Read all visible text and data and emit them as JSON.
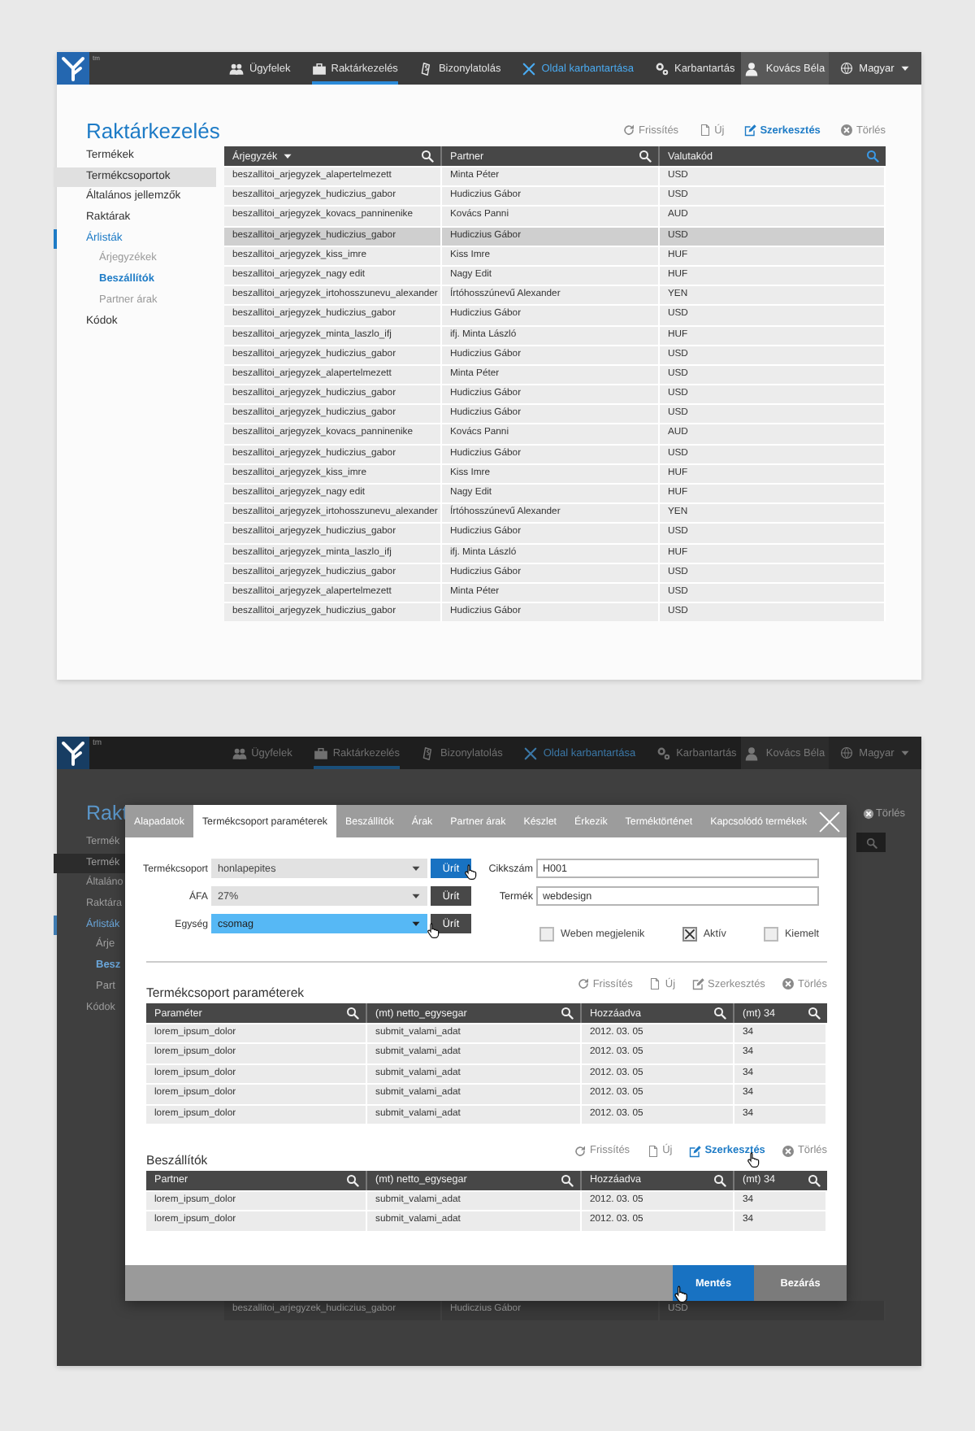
{
  "main_view": {
    "app": {
      "trademark": "tm"
    },
    "nav": [
      {
        "label": "Ügyfelek",
        "kind": "people",
        "selected": false,
        "highlighted": false
      },
      {
        "label": "Raktárkezelés",
        "kind": "briefcase",
        "selected": true,
        "highlighted": false
      },
      {
        "label": "Bizonylatolás",
        "kind": "receipt",
        "selected": false,
        "highlighted": false
      },
      {
        "label": "Oldal karbantartása",
        "kind": "tools",
        "selected": false,
        "highlighted": true
      },
      {
        "label": "Karbantartás",
        "kind": "gears",
        "selected": false,
        "highlighted": false
      }
    ],
    "user": {
      "name": "Kovács Béla"
    },
    "language": {
      "label": "Magyar"
    },
    "title": "Raktárkezelés",
    "toolbar": [
      {
        "label": "Frissítés",
        "kind": "refresh",
        "active": false
      },
      {
        "label": "Új",
        "kind": "new",
        "active": false
      },
      {
        "label": "Szerkesztés",
        "kind": "edit",
        "active": true
      },
      {
        "label": "Törlés",
        "kind": "delete",
        "active": false
      }
    ],
    "sidebar": {
      "items": [
        {
          "label": "Termékek",
          "selected": false,
          "expanded": false
        },
        {
          "label": "Termékcsoportok",
          "selected": true,
          "expanded": false
        },
        {
          "label": "Általános jellemzők",
          "selected": false,
          "expanded": false
        },
        {
          "label": "Raktárak",
          "selected": false,
          "expanded": false
        },
        {
          "label": "Árlisták",
          "selected": false,
          "expanded": true,
          "children": [
            {
              "label": "Árjegyzékek",
              "selected": false
            },
            {
              "label": "Beszállítók",
              "selected": true
            },
            {
              "label": "Partner árak",
              "selected": false
            }
          ]
        },
        {
          "label": "Kódok",
          "selected": false,
          "expanded": false
        }
      ]
    },
    "table": {
      "columns": [
        {
          "label": "Árjegyzék",
          "sortable": true,
          "search_active": false
        },
        {
          "label": "Partner",
          "sortable": false,
          "search_active": false
        },
        {
          "label": "Valutakód",
          "sortable": false,
          "search_active": true
        }
      ],
      "rows": [
        {
          "cells": [
            "beszallitoi_arjegyzek_alapertelmezett",
            "Minta Péter",
            "USD"
          ],
          "selected": false
        },
        {
          "cells": [
            "beszallitoi_arjegyzek_hudiczius_gabor",
            "Hudiczius Gábor",
            "USD"
          ],
          "selected": false
        },
        {
          "cells": [
            "beszallitoi_arjegyzek_kovacs_panninenike",
            "Kovács Panni",
            "AUD"
          ],
          "selected": false
        },
        {
          "cells": [
            "beszallitoi_arjegyzek_hudiczius_gabor",
            "Hudiczius Gábor",
            "USD"
          ],
          "selected": true
        },
        {
          "cells": [
            "beszallitoi_arjegyzek_kiss_imre",
            "Kiss Imre",
            "HUF"
          ],
          "selected": false
        },
        {
          "cells": [
            "beszallitoi_arjegyzek_nagy edit",
            "Nagy Edit",
            "HUF"
          ],
          "selected": false
        },
        {
          "cells": [
            "beszallitoi_arjegyzek_irtohosszunevu_alexander",
            "Írtóhosszúnevű Alexander",
            "YEN"
          ],
          "selected": false
        },
        {
          "cells": [
            "beszallitoi_arjegyzek_hudiczius_gabor",
            "Hudiczius Gábor",
            "USD"
          ],
          "selected": false
        },
        {
          "cells": [
            "beszallitoi_arjegyzek_minta_laszlo_ifj",
            "ifj. Minta László",
            "HUF"
          ],
          "selected": false
        },
        {
          "cells": [
            "beszallitoi_arjegyzek_hudiczius_gabor",
            "Hudiczius Gábor",
            "USD"
          ],
          "selected": false
        },
        {
          "cells": [
            "beszallitoi_arjegyzek_alapertelmezett",
            "Minta Péter",
            "USD"
          ],
          "selected": false
        },
        {
          "cells": [
            "beszallitoi_arjegyzek_hudiczius_gabor",
            "Hudiczius Gábor",
            "USD"
          ],
          "selected": false
        },
        {
          "cells": [
            "beszallitoi_arjegyzek_hudiczius_gabor",
            "Hudiczius Gábor",
            "USD"
          ],
          "selected": false
        },
        {
          "cells": [
            "beszallitoi_arjegyzek_kovacs_panninenike",
            "Kovács Panni",
            "AUD"
          ],
          "selected": false
        },
        {
          "cells": [
            "beszallitoi_arjegyzek_hudiczius_gabor",
            "Hudiczius Gábor",
            "USD"
          ],
          "selected": false
        },
        {
          "cells": [
            "beszallitoi_arjegyzek_kiss_imre",
            "Kiss Imre",
            "HUF"
          ],
          "selected": false
        },
        {
          "cells": [
            "beszallitoi_arjegyzek_nagy edit",
            "Nagy Edit",
            "HUF"
          ],
          "selected": false
        },
        {
          "cells": [
            "beszallitoi_arjegyzek_irtohosszunevu_alexander",
            "Írtóhosszúnevű Alexander",
            "YEN"
          ],
          "selected": false
        },
        {
          "cells": [
            "beszallitoi_arjegyzek_hudiczius_gabor",
            "Hudiczius Gábor",
            "USD"
          ],
          "selected": false
        },
        {
          "cells": [
            "beszallitoi_arjegyzek_minta_laszlo_ifj",
            "ifj. Minta László",
            "HUF"
          ],
          "selected": false
        },
        {
          "cells": [
            "beszallitoi_arjegyzek_hudiczius_gabor",
            "Hudiczius Gábor",
            "USD"
          ],
          "selected": false
        },
        {
          "cells": [
            "beszallitoi_arjegyzek_alapertelmezett",
            "Minta Péter",
            "USD"
          ],
          "selected": false
        },
        {
          "cells": [
            "beszallitoi_arjegyzek_hudiczius_gabor",
            "Hudiczius Gábor",
            "USD"
          ],
          "selected": false
        }
      ]
    }
  },
  "dimmed_view": {
    "app": {
      "trademark": "tm"
    },
    "nav": [
      {
        "label": "Ügyfelek",
        "kind": "people",
        "selected": false,
        "highlighted": false
      },
      {
        "label": "Raktárkezelés",
        "kind": "briefcase",
        "selected": true,
        "highlighted": false
      },
      {
        "label": "Bizonylatolás",
        "kind": "receipt",
        "selected": false,
        "highlighted": false
      },
      {
        "label": "Oldal karbantartása",
        "kind": "tools",
        "selected": false,
        "highlighted": true
      },
      {
        "label": "Karbantartás",
        "kind": "gears",
        "selected": false,
        "highlighted": false
      }
    ],
    "user": {
      "name": "Kovács Béla"
    },
    "language": {
      "label": "Magyar"
    },
    "background": {
      "title": "Rakt",
      "toolbar": [
        {
          "label": "Törlés",
          "kind": "delete"
        }
      ],
      "sidebar": {
        "items": [
          {
            "label": "Termék",
            "selected": false,
            "expanded": false
          },
          {
            "label": "Termék",
            "selected": true,
            "expanded": false
          },
          {
            "label": "Általáno",
            "selected": false,
            "expanded": false
          },
          {
            "label": "Raktára",
            "selected": false,
            "expanded": false
          },
          {
            "label": "Árlisták",
            "selected": false,
            "expanded": true,
            "children": [
              {
                "label": "Árje",
                "selected": false
              },
              {
                "label": "Besz",
                "selected": true
              },
              {
                "label": "Part",
                "selected": false
              }
            ]
          },
          {
            "label": "Kódok",
            "selected": false,
            "expanded": false
          }
        ]
      },
      "rows": [
        {
          "cells": [
            "beszallitoi_arjegyzek_hudiczius_gabor",
            "Hudiczius Gábor",
            "USD"
          ]
        }
      ]
    },
    "dialog": {
      "tabs": [
        {
          "label": "Alapadatok",
          "selected": false
        },
        {
          "label": "Termékcsoport paraméterek",
          "selected": true
        },
        {
          "label": "Beszállítók",
          "selected": false
        },
        {
          "label": "Árak",
          "selected": false
        },
        {
          "label": "Partner árak",
          "selected": false
        },
        {
          "label": "Készlet",
          "selected": false
        },
        {
          "label": "Érkezik",
          "selected": false
        },
        {
          "label": "Terméktörténet",
          "selected": false
        },
        {
          "label": "Kapcsolódó termékek",
          "selected": false
        }
      ],
      "selects": [
        {
          "label": "Termékcsoport",
          "value": "honlapepites",
          "focused": false,
          "cursor": false,
          "button": {
            "label": "Ürít",
            "hover": true,
            "cursor": true
          }
        },
        {
          "label": "ÁFA",
          "value": "27%",
          "focused": false,
          "cursor": false,
          "button": {
            "label": "Ürít",
            "hover": false,
            "cursor": false
          }
        },
        {
          "label": "Egység",
          "value": "csomag",
          "focused": true,
          "cursor": true,
          "button": {
            "label": "Ürít",
            "hover": false,
            "cursor": false
          }
        }
      ],
      "fields": [
        {
          "label": "Cikkszám",
          "value": "H001"
        },
        {
          "label": "Termék",
          "value": "webdesign"
        }
      ],
      "checkboxes": [
        {
          "label": "Weben megjelenik",
          "checked": false
        },
        {
          "label": "Aktív",
          "checked": true
        },
        {
          "label": "Kiemelt",
          "checked": false
        }
      ],
      "sections": [
        {
          "title": "Termékcsoport paraméterek",
          "toolbar": [
            {
              "label": "Frissítés",
              "kind": "refresh",
              "active": false,
              "cursor": false
            },
            {
              "label": "Új",
              "kind": "new",
              "active": false,
              "cursor": false
            },
            {
              "label": "Szerkesztés",
              "kind": "edit",
              "active": false,
              "cursor": false
            },
            {
              "label": "Törlés",
              "kind": "delete",
              "active": false,
              "cursor": false
            }
          ],
          "columns": [
            "Paraméter",
            "(mt) netto_egysegar",
            "Hozzáadva",
            "(mt) 34"
          ],
          "rows": [
            [
              "lorem_ipsum_dolor",
              "submit_valami_adat",
              "2012. 03. 05",
              "34"
            ],
            [
              "lorem_ipsum_dolor",
              "submit_valami_adat",
              "2012. 03. 05",
              "34"
            ],
            [
              "lorem_ipsum_dolor",
              "submit_valami_adat",
              "2012. 03. 05",
              "34"
            ],
            [
              "lorem_ipsum_dolor",
              "submit_valami_adat",
              "2012. 03. 05",
              "34"
            ],
            [
              "lorem_ipsum_dolor",
              "submit_valami_adat",
              "2012. 03. 05",
              "34"
            ]
          ]
        },
        {
          "title": "Beszállítók",
          "toolbar": [
            {
              "label": "Frissítés",
              "kind": "refresh",
              "active": false,
              "cursor": false
            },
            {
              "label": "Új",
              "kind": "new",
              "active": false,
              "cursor": false
            },
            {
              "label": "Szerkesztés",
              "kind": "edit",
              "active": true,
              "cursor": true
            },
            {
              "label": "Törlés",
              "kind": "delete",
              "active": false,
              "cursor": false
            }
          ],
          "columns": [
            "Partner",
            "(mt) netto_egysegar",
            "Hozzáadva",
            "(mt) 34"
          ],
          "rows": [
            [
              "lorem_ipsum_dolor",
              "submit_valami_adat",
              "2012. 03. 05",
              "34"
            ],
            [
              "lorem_ipsum_dolor",
              "submit_valami_adat",
              "2012. 03. 05",
              "34"
            ]
          ]
        }
      ],
      "buttons": [
        {
          "label": "Mentés",
          "primary": true,
          "cursor": true
        },
        {
          "label": "Bezárás",
          "primary": false,
          "cursor": false
        }
      ]
    }
  }
}
